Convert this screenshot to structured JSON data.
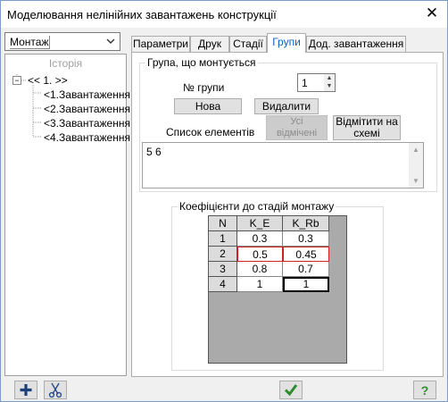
{
  "window": {
    "title": "Моделювання нелінійних завантажень конструкції"
  },
  "mode": {
    "selected": "Монтаж"
  },
  "history": {
    "title": "Історія",
    "root": "<< 1. >>",
    "items": [
      "<1.Завантаження",
      "<2.Завантаження",
      "<3.Завантаження",
      "<4.Завантаження"
    ]
  },
  "tabs": [
    "Параметри",
    "Друк",
    "Стадії",
    "Групи",
    "Дод. завантаження"
  ],
  "active_tab": "Групи",
  "group_section": {
    "title": "Група, що монтується",
    "group_no_label": "№ групи",
    "group_no_value": "1",
    "new_button": "Нова",
    "delete_button": "Видалити",
    "elements_label": "Список елементів",
    "all_selected_button": [
      "Усі",
      "відмічені"
    ],
    "mark_on_scheme_button": [
      "Відмітити на",
      "схемі"
    ],
    "elements_value": "5 6"
  },
  "coefficients": {
    "title": "Коефіцієнти до стадій монтажу",
    "columns": [
      "N",
      "K_E",
      "K_Rb"
    ],
    "rows": [
      [
        "1",
        "0.3",
        "0.3"
      ],
      [
        "2",
        "0.5",
        "0.45"
      ],
      [
        "3",
        "0.8",
        "0.7"
      ],
      [
        "4",
        "1",
        "1"
      ]
    ]
  },
  "colors": {
    "accent": "#0a60c2",
    "selection_border": "#d02020",
    "ok_green": "#2e8b2e"
  },
  "icons": {
    "add": "plus-icon",
    "cut": "scissors-icon",
    "ok": "checkmark-icon",
    "help": "question-icon"
  }
}
